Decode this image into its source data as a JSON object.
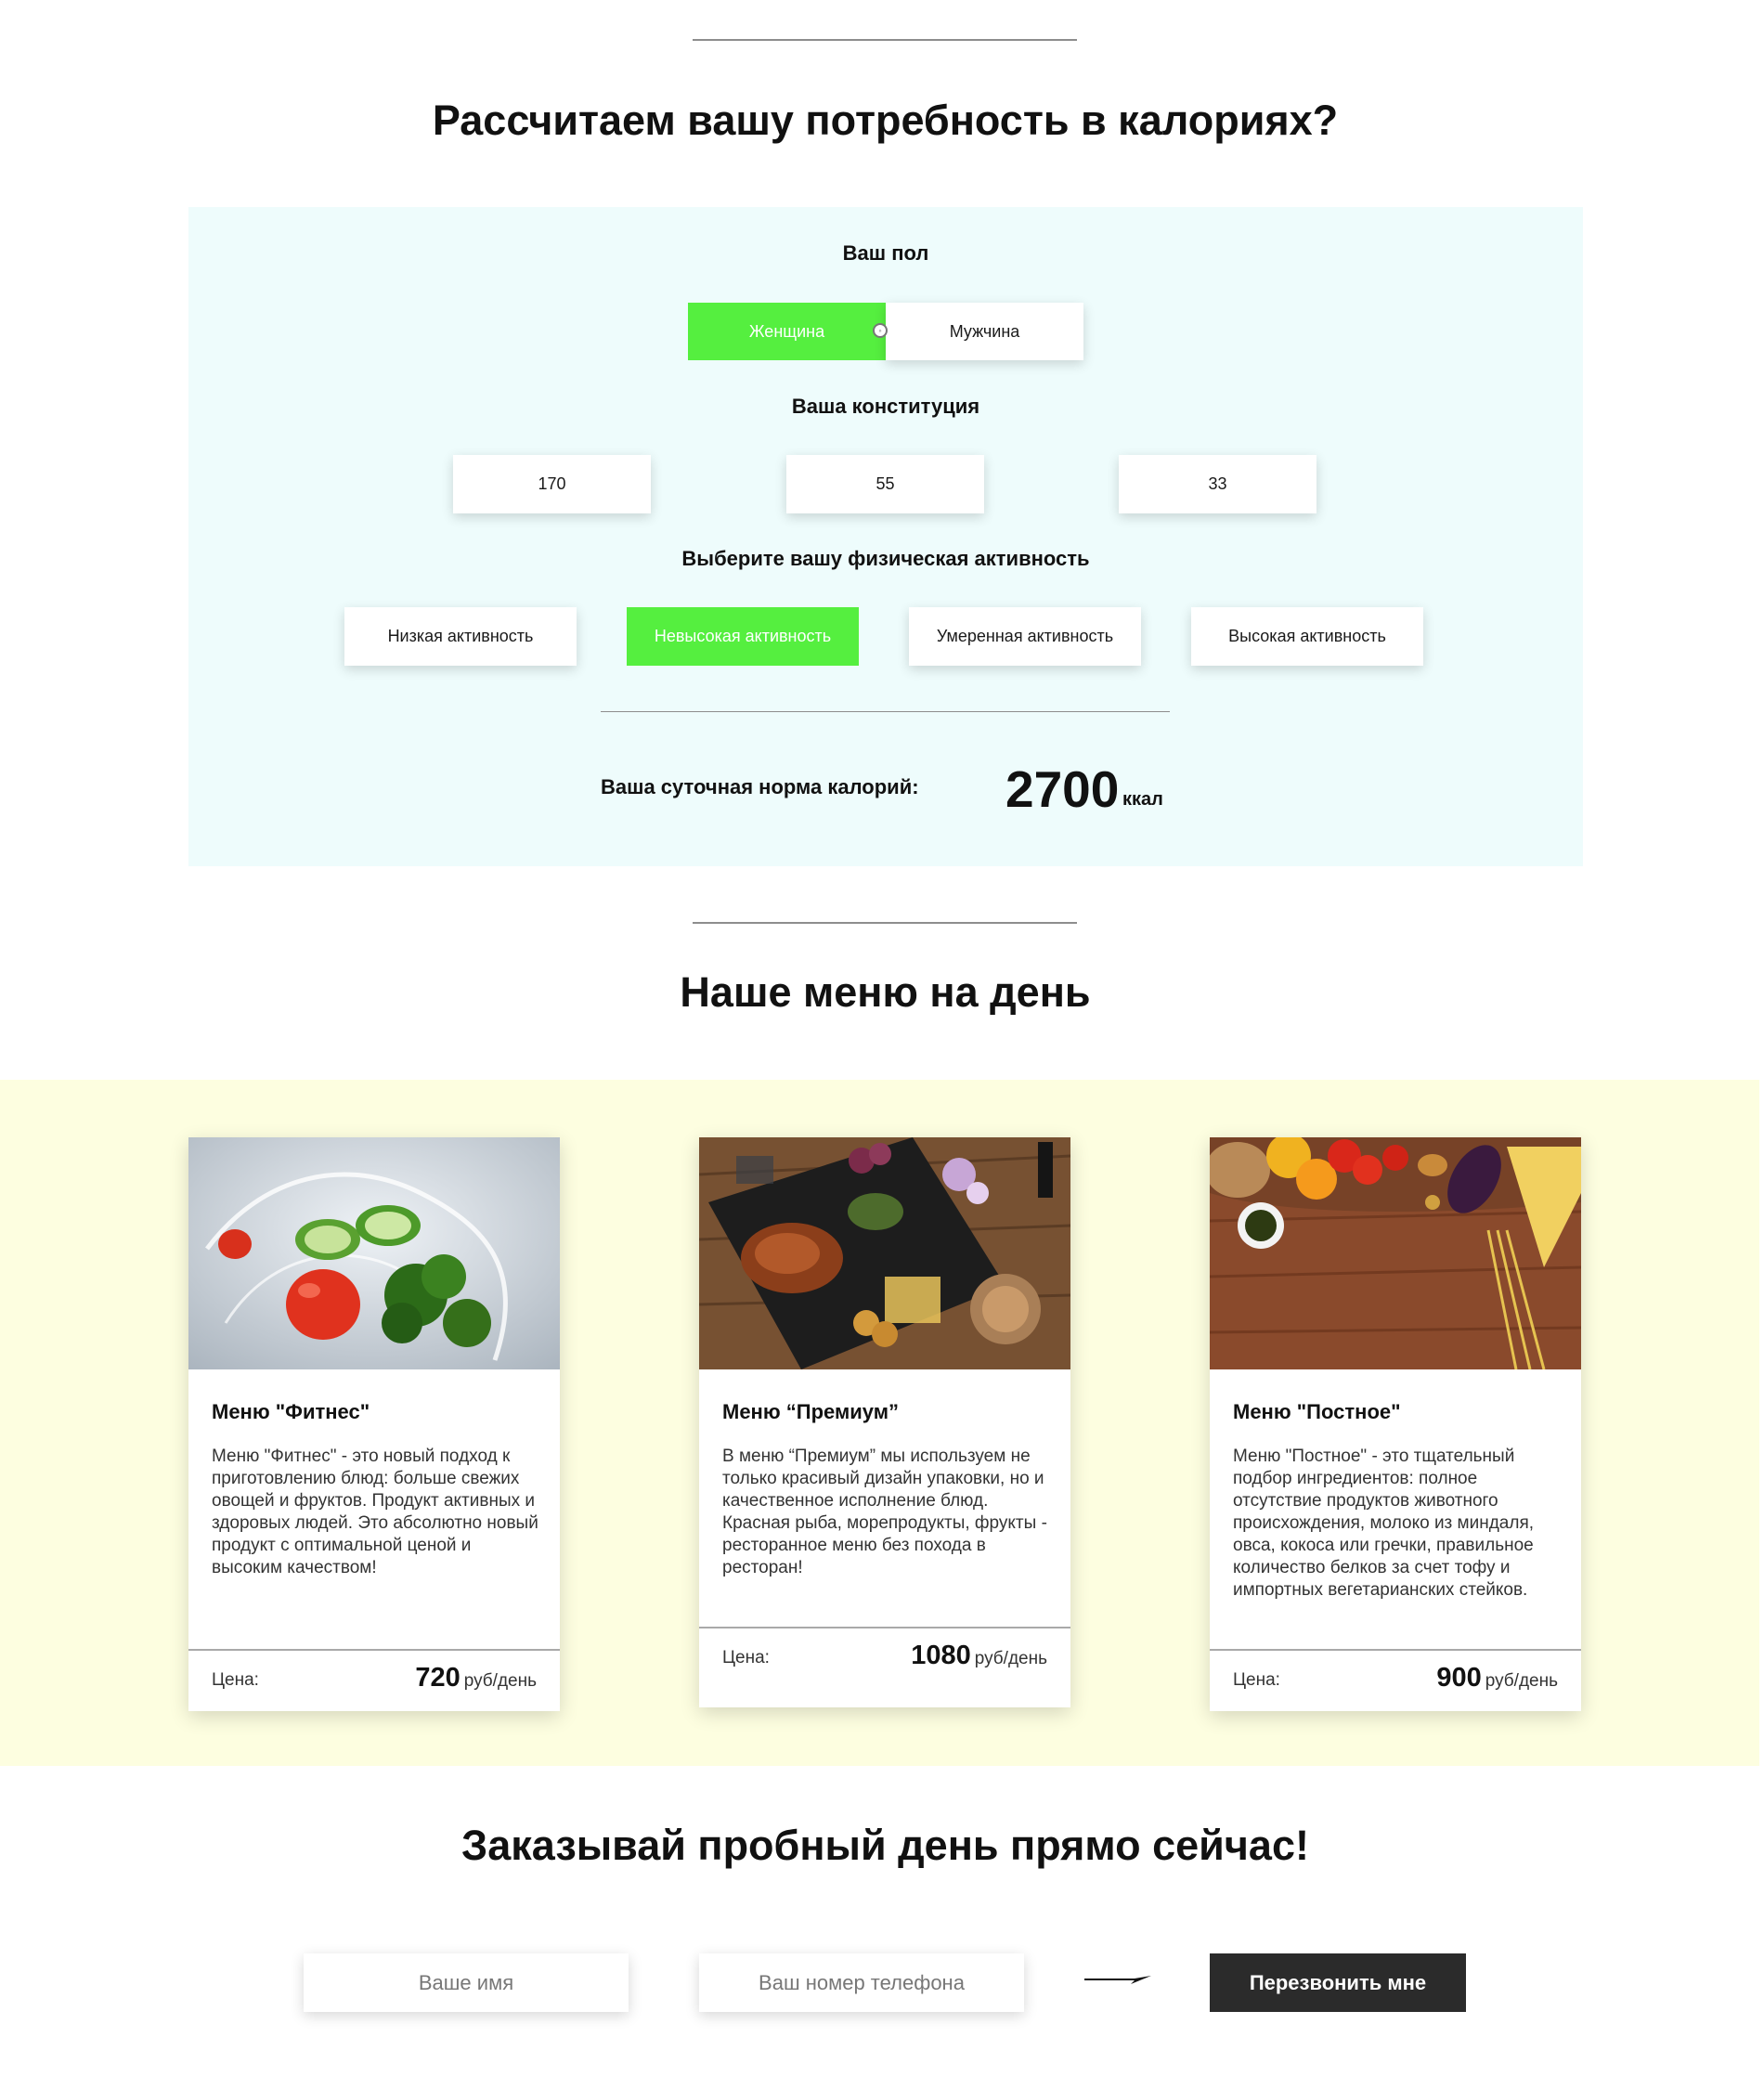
{
  "calculator": {
    "heading": "Рассчитаем вашу потребность в калориях?",
    "gender_label": "Ваш пол",
    "gender_options": [
      "Женщина",
      "Мужчина"
    ],
    "gender_selected": "Женщина",
    "constitution_label": "Ваша конституция",
    "constitution_values": [
      "170",
      "55",
      "33"
    ],
    "activity_label": "Выберите вашу физическая активность",
    "activity_options": [
      "Низкая активность",
      "Невысокая активность",
      "Умеренная активность",
      "Высокая активность"
    ],
    "activity_selected": "Невысокая активность",
    "result_label": "Ваша суточная норма калорий:",
    "result_value": "2700",
    "result_unit": "ккал"
  },
  "menu": {
    "heading": "Наше меню на день",
    "price_label": "Цена:",
    "price_unit": "руб/день",
    "cards": [
      {
        "title": "Меню \"Фитнес\"",
        "description": "Меню \"Фитнес\" - это новый подход к приготовлению блюд: больше свежих овощей и фруктов. Продукт активных и здоровых людей. Это абсолютно новый продукт с оптимальной ценой и высоким качеством!",
        "price": "720"
      },
      {
        "title": "Меню “Премиум”",
        "description": "В меню “Премиум” мы используем не только красивый дизайн упаковки, но и качественное исполнение блюд. Красная рыба, морепродукты, фрукты - ресторанное меню без похода в ресторан!",
        "price": "1080"
      },
      {
        "title": "Меню \"Постное\"",
        "description": "Меню \"Постное\" - это тщательный подбор ингредиентов: полное отсутствие продуктов животного происхождения, молоко из миндаля, овса, кокоса или гречки, правильное количество белков за счет тофу и импортных вегетарианских стейков.",
        "price": "900"
      }
    ]
  },
  "order": {
    "heading": "Заказывай пробный день прямо сейчас!",
    "name_placeholder": "Ваше имя",
    "phone_placeholder": "Ваш номер телефона",
    "submit_label": "Перезвонить мне"
  },
  "colors": {
    "accent_green": "#55ef3f",
    "calc_background": "#eefcfc",
    "menu_background": "#fdfee0",
    "button_dark": "#2b2b2b"
  }
}
